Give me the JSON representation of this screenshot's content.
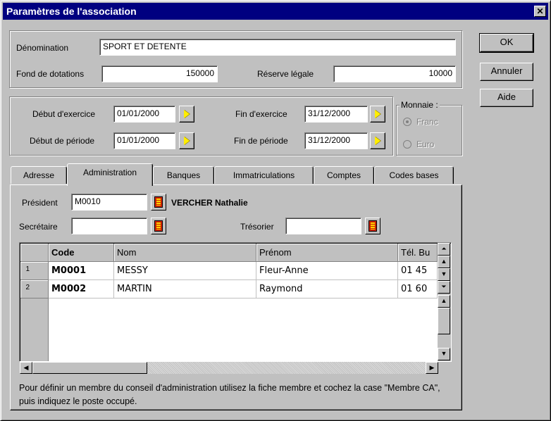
{
  "window": {
    "title": "Paramètres de l'association",
    "close_glyph": "✕"
  },
  "buttons": {
    "ok": "OK",
    "cancel": "Annuler",
    "help": "Aide"
  },
  "identity": {
    "denomination_label": "Dénomination",
    "denomination_value": "SPORT ET DETENTE",
    "fond_label": "Fond de dotations",
    "fond_value": "150000",
    "reserve_label": "Réserve légale",
    "reserve_value": "10000"
  },
  "periods": {
    "debut_exercice_label": "Début d'exercice",
    "debut_exercice_value": "01/01/2000",
    "fin_exercice_label": "Fin d'exercice",
    "fin_exercice_value": "31/12/2000",
    "debut_periode_label": "Début de période",
    "debut_periode_value": "01/01/2000",
    "fin_periode_label": "Fin de période",
    "fin_periode_value": "31/12/2000"
  },
  "currency": {
    "label": "Monnaie :",
    "options": [
      "Franc",
      "Euro"
    ],
    "selected": "Franc",
    "enabled": false
  },
  "tabs": [
    {
      "label": "Adresse",
      "active": false
    },
    {
      "label": "Administration",
      "active": true
    },
    {
      "label": "Banques",
      "active": false
    },
    {
      "label": "Immatriculations",
      "active": false
    },
    {
      "label": "Comptes",
      "active": false
    },
    {
      "label": "Codes bases",
      "active": false
    }
  ],
  "administration": {
    "president_label": "Président",
    "president_code": "M0010",
    "president_name": "VERCHER Nathalie",
    "secretaire_label": "Secrétaire",
    "secretaire_value": "",
    "tresorier_label": "Trésorier",
    "tresorier_value": ""
  },
  "members_table": {
    "columns": [
      "Code",
      "Nom",
      "Prénom",
      "Tél. Bu"
    ],
    "rows": [
      {
        "num": "1",
        "code": "M0001",
        "nom": "MESSY",
        "prenom": "Fleur-Anne",
        "tel": "01 45"
      },
      {
        "num": "2",
        "code": "M0002",
        "nom": "MARTIN",
        "prenom": "Raymond",
        "tel": "01 60"
      }
    ]
  },
  "note": "Pour définir un membre du conseil d'administration utilisez la fiche membre et cochez la case \"Membre CA\", puis indiquez le poste occupé.",
  "colors": {
    "title_bar": "#000080",
    "face": "#c0c0c0",
    "lookup_icon": "#ffd200",
    "date_arrow": "#ffee00"
  },
  "icons": {
    "date_picker": "yellow-right-triangle",
    "member_lookup": "book-icon",
    "scroll_top": "double-up-arrow",
    "scroll_bottom": "double-down-arrow"
  }
}
